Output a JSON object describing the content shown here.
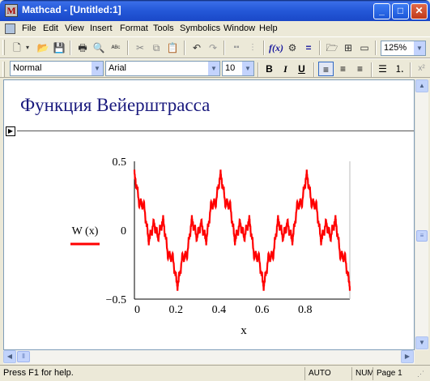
{
  "window": {
    "title": "Mathcad - [Untitled:1]",
    "controls": {
      "minimize": "_",
      "maximize": "□",
      "close": "✕"
    }
  },
  "menu": [
    "File",
    "Edit",
    "View",
    "Insert",
    "Format",
    "Tools",
    "Symbolics",
    "Window",
    "Help"
  ],
  "toolbar": {
    "zoom": "125%"
  },
  "format_bar": {
    "style": "Normal",
    "font": "Arial",
    "size": "10",
    "bold": "B",
    "italic": "I",
    "underline": "U"
  },
  "worksheet": {
    "title": "Функция Вейерштрасса",
    "legend_label": "W (x)",
    "plot_color": "#ff0000",
    "title_color": "#1a1a7e"
  },
  "chart_data": {
    "type": "line",
    "series": [
      {
        "name": "W (x)",
        "function": "weierstrass"
      }
    ],
    "xlabel": "x",
    "xlim": [
      0,
      1
    ],
    "ylim": [
      -0.5,
      0.5
    ],
    "xticks": [
      "0",
      "0.2",
      "0.4",
      "0.6",
      "0.8"
    ],
    "yticks": [
      "0.5",
      "0",
      "−0.5"
    ]
  },
  "status": {
    "help": "Press F1 for help.",
    "mode": "AUTO",
    "num": "NUM",
    "page": "Page 1"
  }
}
